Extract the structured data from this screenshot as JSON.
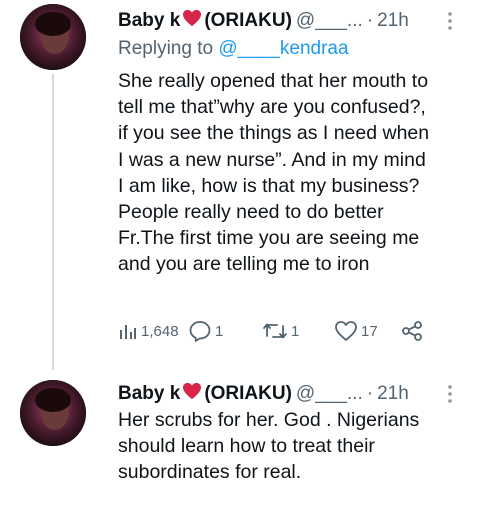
{
  "tweets": [
    {
      "author": {
        "name_prefix": "Baby k",
        "name_suffix": "(ORIAKU)",
        "handle": "@___...",
        "dot": "·",
        "time": "21h"
      },
      "reply": {
        "prefix": "Replying to",
        "mention": "@____kendraa"
      },
      "text_lines": [
        "She really opened that her mouth to",
        "tell me that”why are you confused?,",
        "if you see the things as I need when",
        "I was a new nurse”. And in my mind",
        "I am like, how is that my business?",
        "People really need to do better",
        "Fr.The first time you are seeing me",
        "and you are telling me to iron"
      ],
      "stats": {
        "views": "1,648",
        "replies": "1",
        "retweets": "1",
        "likes": "17"
      }
    },
    {
      "author": {
        "name_prefix": "Baby k",
        "name_suffix": "(ORIAKU)",
        "handle": "@___...",
        "dot": "·",
        "time": "21h"
      },
      "text_lines": [
        "Her scrubs for her. God . Nigerians",
        "should learn how to treat their",
        "subordinates for real."
      ]
    }
  ],
  "colors": {
    "heart": "#d7264a",
    "link": "#1d9bf0",
    "muted": "#536471",
    "thread": "#cfd9de"
  },
  "icons": [
    "heart-icon",
    "more-icon",
    "views-icon",
    "reply-icon",
    "retweet-icon",
    "like-icon",
    "share-icon"
  ]
}
